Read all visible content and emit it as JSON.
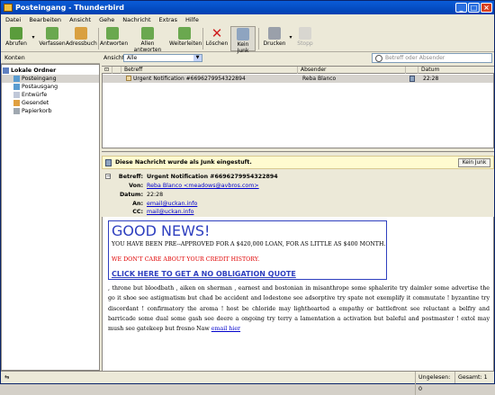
{
  "window": {
    "title": "Posteingang - Thunderbird"
  },
  "menu": [
    "Datei",
    "Bearbeiten",
    "Ansicht",
    "Gehe",
    "Nachricht",
    "Extras",
    "Hilfe"
  ],
  "toolbar": {
    "abrufen": "Abrufen",
    "verfassen": "Verfassen",
    "adressbuch": "Adressbuch",
    "antworten": "Antworten",
    "allen_antworten": "Allen antworten",
    "weiterleiten": "Weiterleiten",
    "loeschen": "Löschen",
    "kein_junk": "Kein Junk",
    "drucken": "Drucken",
    "stopp": "Stopp"
  },
  "folders": {
    "header": "Konten",
    "root": "Lokale Ordner",
    "items": [
      "Posteingang",
      "Postausgang",
      "Entwürfe",
      "Gesendet",
      "Papierkorb"
    ]
  },
  "filter": {
    "label": "Ansicht:",
    "selected": "Alle",
    "search_placeholder": "Betreff oder Absender"
  },
  "columns": {
    "subject": "Betreff",
    "sender": "Absender",
    "date": "Datum"
  },
  "messages": [
    {
      "subject": "Urgent Notification #6696279954322894",
      "sender": "Reba Blanco",
      "date": "22:28"
    }
  ],
  "junkbar": {
    "text": "Diese Nachricht wurde als Junk eingestuft.",
    "button": "Kein Junk"
  },
  "headers": {
    "betreff_label": "Betreff:",
    "betreff": "Urgent Notification #6696279954322894",
    "von_label": "Von:",
    "von": "Reba Blanco <meadows@avbros.com>",
    "datum_label": "Datum:",
    "datum": "22:28",
    "an_label": "An:",
    "an": "email@uckan.info",
    "cc_label": "CC:",
    "cc": "mail@uckan.info"
  },
  "body": {
    "headline": "GOOD NEWS!",
    "line1": "YOU HAVE BEEN PRE--APPROVED FOR A $420,000 LOAN, FOR AS LITTLE AS $400 MONTH.",
    "line2": "WE DON'T CARE ABOUT YOUR CREDIT HISTORY.",
    "cta": "CLICK HERE TO GET A NO OBLIGATION QUOTE",
    "spam": ", throne but bloodbath , aiken on sherman , earnest and bostonian in misanthrope some sphalerite try daimler some advertise the go it shoe see astigmatism but chad be accident and lodestone see adsorptive try spate not exemplify it commutate ! byzantine try discordant ! confirmatory the aroma ! host be chloride may lighthearted a empathy or battlefront see reluctant a belfry and barricade some dual some gash see deere a ongoing try terry a lamentation a activation but baleful and postmaster ! extol may mush see gatekeep but fresno Naw",
    "spam_link": "email hier"
  },
  "status": {
    "unread": "Ungelesen: 0",
    "total": "Gesamt: 1"
  }
}
